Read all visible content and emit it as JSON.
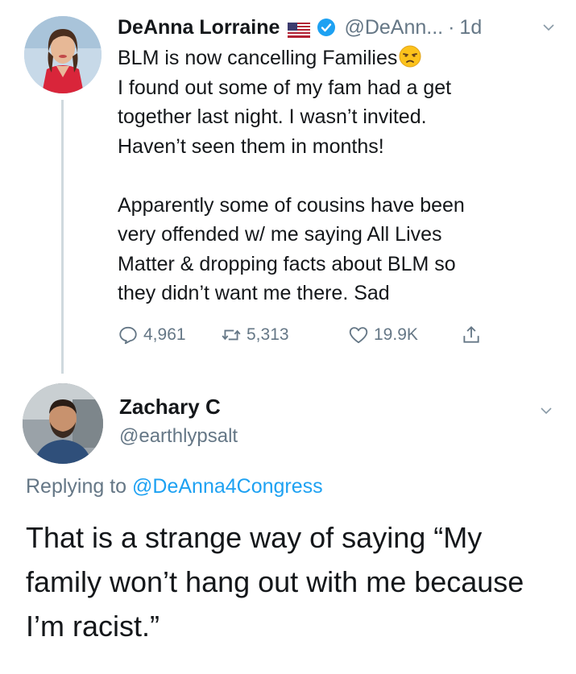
{
  "tweet": {
    "author_name": "DeAnna Lorraine",
    "author_handle": "@DeAnn...",
    "separator": "·",
    "time": "1d",
    "text_line1": "BLM is now cancelling Families",
    "text_rest": "I found out some of my fam had a get\ntogether last night. I wasn’t invited.\nHaven’t seen them in months!\n\nApparently some of cousins have been\nvery offended w/ me saying All Lives\nMatter & dropping facts about BLM so\nthey didn’t want me there. Sad",
    "emoji_icon": "unamused-face-emoji",
    "stats": {
      "replies": "4,961",
      "retweets": "5,313",
      "likes": "19.9K"
    }
  },
  "reply": {
    "author_name": "Zachary C",
    "author_handle": "@earthlypsalt",
    "replying_prefix": "Replying to ",
    "replying_to": "@DeAnna4Congress",
    "text": "That is a strange way of saying “My family won’t hang out with me because I’m racist.”"
  },
  "colors": {
    "text": "#14171a",
    "secondary": "#657786",
    "accent": "#1da1f2",
    "thread_line": "#cfd9de"
  }
}
